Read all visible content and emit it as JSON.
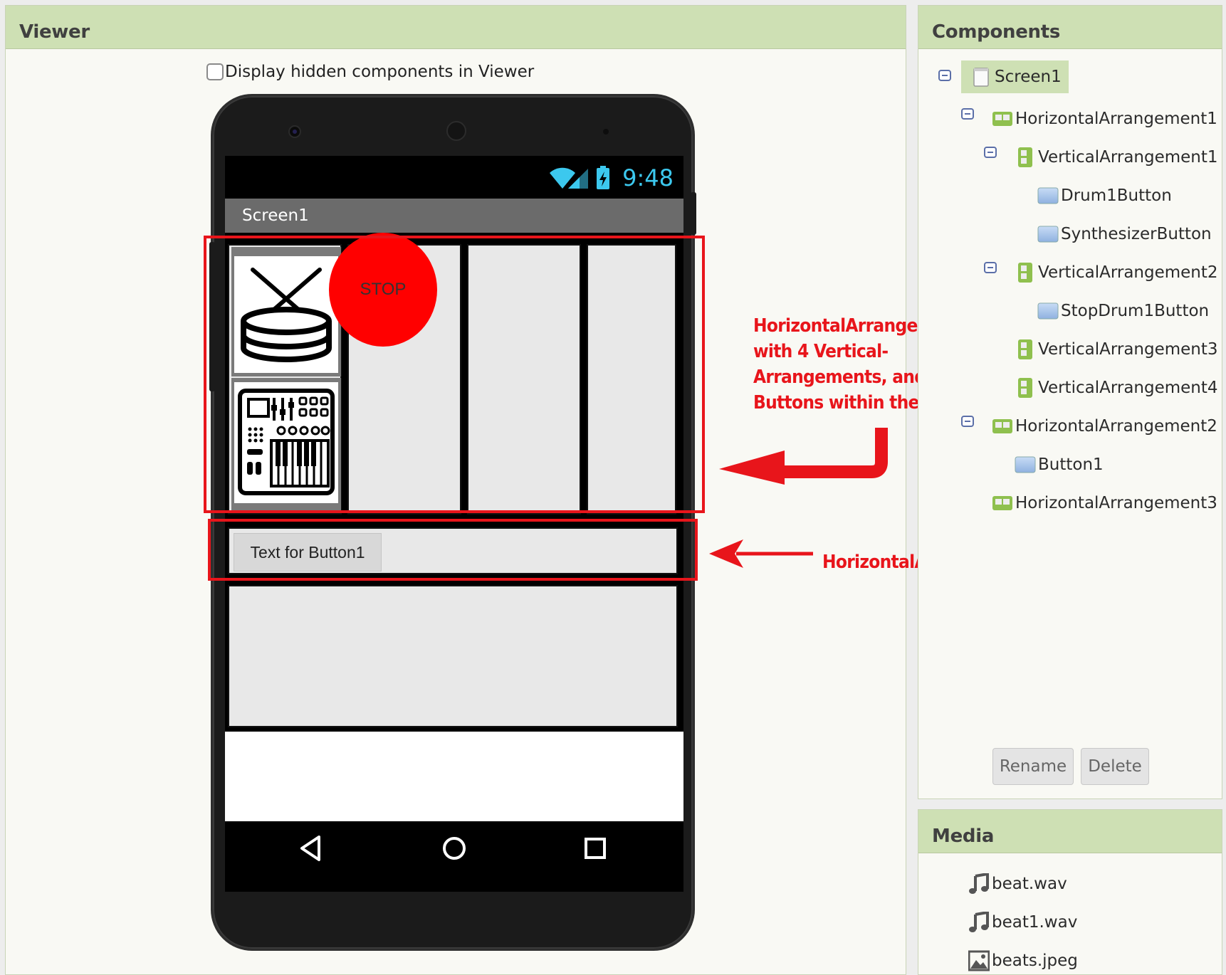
{
  "viewer": {
    "title": "Viewer",
    "hidden_components_label": "Display hidden components in Viewer",
    "phone": {
      "status_time": "9:48",
      "screen_title": "Screen1",
      "stop_button_label": "STOP",
      "button1_label": "Text for Button1"
    },
    "annotations": {
      "top_lines": [
        "HorizontalArrangement",
        "with 4 Vertical-",
        "Arrangements, and",
        "Buttons within them"
      ],
      "bottom": "HorizontalArrangement",
      "color": "#e8151b"
    }
  },
  "components": {
    "title": "Components",
    "tree": [
      {
        "label": "Screen1",
        "icon": "screen-icon",
        "selected": true
      },
      {
        "label": "HorizontalArrangement1",
        "icon": "horizontal-arrangement-icon"
      },
      {
        "label": "VerticalArrangement1",
        "icon": "vertical-arrangement-icon"
      },
      {
        "label": "Drum1Button",
        "icon": "button-icon"
      },
      {
        "label": "SynthesizerButton",
        "icon": "button-icon"
      },
      {
        "label": "VerticalArrangement2",
        "icon": "vertical-arrangement-icon"
      },
      {
        "label": "StopDrum1Button",
        "icon": "button-icon"
      },
      {
        "label": "VerticalArrangement3",
        "icon": "vertical-arrangement-icon"
      },
      {
        "label": "VerticalArrangement4",
        "icon": "vertical-arrangement-icon"
      },
      {
        "label": "HorizontalArrangement2",
        "icon": "horizontal-arrangement-icon"
      },
      {
        "label": "Button1",
        "icon": "button-icon"
      },
      {
        "label": "HorizontalArrangement3",
        "icon": "horizontal-arrangement-icon"
      }
    ],
    "rename_label": "Rename",
    "delete_label": "Delete"
  },
  "media": {
    "title": "Media",
    "files": [
      {
        "name": "beat.wav",
        "icon": "audio-file-icon"
      },
      {
        "name": "beat1.wav",
        "icon": "audio-file-icon"
      },
      {
        "name": "beats.jpeg",
        "icon": "image-file-icon"
      }
    ]
  },
  "colors": {
    "panel_header": "#cee0b4",
    "stop_button": "#ff0000",
    "status_accent": "#3cc8ee",
    "annotation": "#e8151b"
  }
}
